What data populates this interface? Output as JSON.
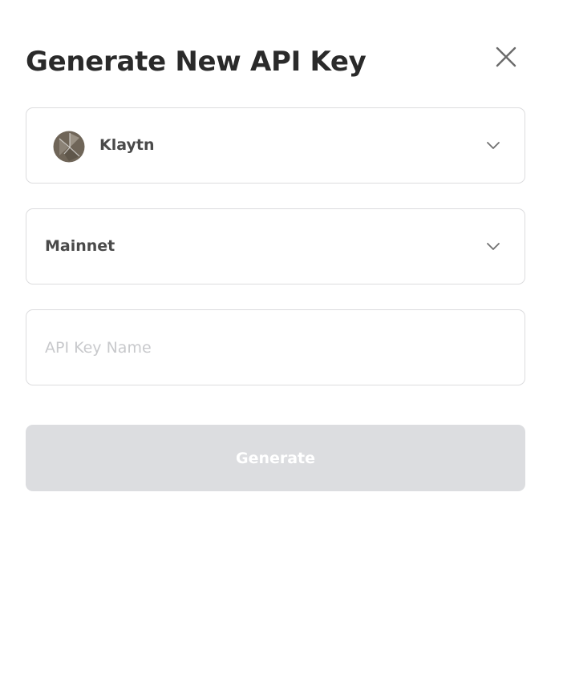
{
  "dialog": {
    "title": "Generate New API Key",
    "close_icon": "close-icon"
  },
  "chain_select": {
    "selected_label": "Klaytn",
    "logo_icon": "klaytn-logo-icon",
    "chevron_icon": "chevron-down-icon"
  },
  "network_select": {
    "selected_label": "Mainnet",
    "chevron_icon": "chevron-down-icon"
  },
  "api_key_name": {
    "value": "",
    "placeholder": "API Key Name"
  },
  "generate_button": {
    "label": "Generate",
    "disabled": true
  },
  "colors": {
    "title_text": "#2a2a2a",
    "field_border": "#dcdcde",
    "placeholder_text": "#c8c9cc",
    "button_disabled_bg": "#dcdde0",
    "button_disabled_text": "#ffffff",
    "klaytn_logo": "#6f6558"
  }
}
